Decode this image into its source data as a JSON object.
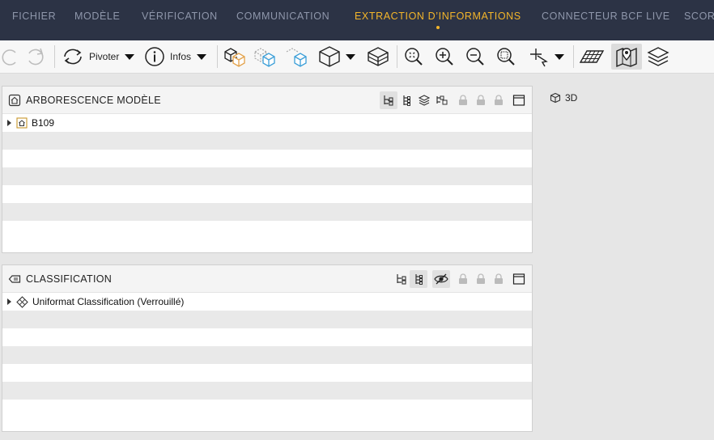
{
  "menu": {
    "items": [
      {
        "label": "FICHIER"
      },
      {
        "label": "MODÈLE"
      },
      {
        "label": "VÉRIFICATION"
      },
      {
        "label": "COMMUNICATION"
      },
      {
        "label": "EXTRACTION D’INFORMATIONS",
        "active": true
      },
      {
        "label": "CONNECTEUR BCF LIVE"
      },
      {
        "label": "SCORI"
      }
    ]
  },
  "toolbar": {
    "rotate_label": "Pivoter",
    "info_label": "Infos"
  },
  "tree_panel": {
    "title": "ARBORESCENCE MODÈLE",
    "rows": [
      {
        "label": "B109"
      }
    ]
  },
  "classification_panel": {
    "title": "CLASSIFICATION",
    "rows": [
      {
        "label": "Uniformat Classification (Verrouillé)"
      }
    ]
  },
  "view": {
    "label": "3D"
  },
  "colors": {
    "menubar_bg": "#2c3345",
    "menu_text": "#8f97ab",
    "accent": "#f3b52a",
    "cube_accent_orange": "#e3a24a",
    "cube_accent_blue": "#3c9fd8"
  }
}
